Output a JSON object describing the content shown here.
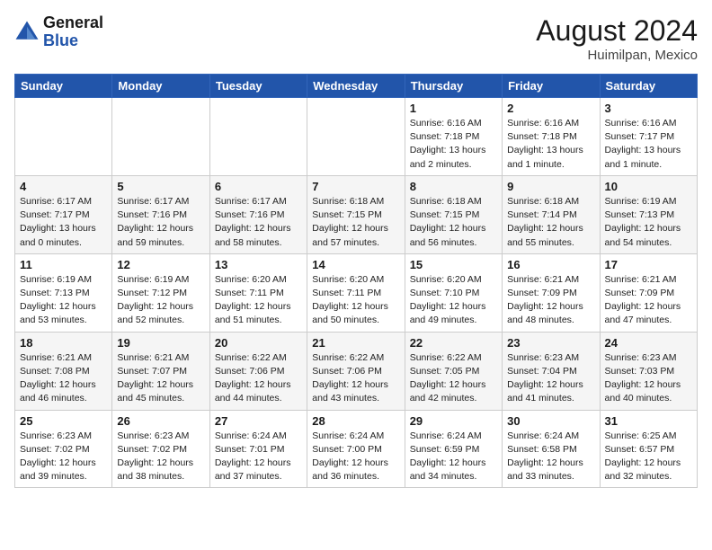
{
  "header": {
    "logo_line1": "General",
    "logo_line2": "Blue",
    "month_year": "August 2024",
    "location": "Huimilpan, Mexico"
  },
  "weekdays": [
    "Sunday",
    "Monday",
    "Tuesday",
    "Wednesday",
    "Thursday",
    "Friday",
    "Saturday"
  ],
  "weeks": [
    [
      {
        "day": "",
        "info": ""
      },
      {
        "day": "",
        "info": ""
      },
      {
        "day": "",
        "info": ""
      },
      {
        "day": "",
        "info": ""
      },
      {
        "day": "1",
        "info": "Sunrise: 6:16 AM\nSunset: 7:18 PM\nDaylight: 13 hours\nand 2 minutes."
      },
      {
        "day": "2",
        "info": "Sunrise: 6:16 AM\nSunset: 7:18 PM\nDaylight: 13 hours\nand 1 minute."
      },
      {
        "day": "3",
        "info": "Sunrise: 6:16 AM\nSunset: 7:17 PM\nDaylight: 13 hours\nand 1 minute."
      }
    ],
    [
      {
        "day": "4",
        "info": "Sunrise: 6:17 AM\nSunset: 7:17 PM\nDaylight: 13 hours\nand 0 minutes."
      },
      {
        "day": "5",
        "info": "Sunrise: 6:17 AM\nSunset: 7:16 PM\nDaylight: 12 hours\nand 59 minutes."
      },
      {
        "day": "6",
        "info": "Sunrise: 6:17 AM\nSunset: 7:16 PM\nDaylight: 12 hours\nand 58 minutes."
      },
      {
        "day": "7",
        "info": "Sunrise: 6:18 AM\nSunset: 7:15 PM\nDaylight: 12 hours\nand 57 minutes."
      },
      {
        "day": "8",
        "info": "Sunrise: 6:18 AM\nSunset: 7:15 PM\nDaylight: 12 hours\nand 56 minutes."
      },
      {
        "day": "9",
        "info": "Sunrise: 6:18 AM\nSunset: 7:14 PM\nDaylight: 12 hours\nand 55 minutes."
      },
      {
        "day": "10",
        "info": "Sunrise: 6:19 AM\nSunset: 7:13 PM\nDaylight: 12 hours\nand 54 minutes."
      }
    ],
    [
      {
        "day": "11",
        "info": "Sunrise: 6:19 AM\nSunset: 7:13 PM\nDaylight: 12 hours\nand 53 minutes."
      },
      {
        "day": "12",
        "info": "Sunrise: 6:19 AM\nSunset: 7:12 PM\nDaylight: 12 hours\nand 52 minutes."
      },
      {
        "day": "13",
        "info": "Sunrise: 6:20 AM\nSunset: 7:11 PM\nDaylight: 12 hours\nand 51 minutes."
      },
      {
        "day": "14",
        "info": "Sunrise: 6:20 AM\nSunset: 7:11 PM\nDaylight: 12 hours\nand 50 minutes."
      },
      {
        "day": "15",
        "info": "Sunrise: 6:20 AM\nSunset: 7:10 PM\nDaylight: 12 hours\nand 49 minutes."
      },
      {
        "day": "16",
        "info": "Sunrise: 6:21 AM\nSunset: 7:09 PM\nDaylight: 12 hours\nand 48 minutes."
      },
      {
        "day": "17",
        "info": "Sunrise: 6:21 AM\nSunset: 7:09 PM\nDaylight: 12 hours\nand 47 minutes."
      }
    ],
    [
      {
        "day": "18",
        "info": "Sunrise: 6:21 AM\nSunset: 7:08 PM\nDaylight: 12 hours\nand 46 minutes."
      },
      {
        "day": "19",
        "info": "Sunrise: 6:21 AM\nSunset: 7:07 PM\nDaylight: 12 hours\nand 45 minutes."
      },
      {
        "day": "20",
        "info": "Sunrise: 6:22 AM\nSunset: 7:06 PM\nDaylight: 12 hours\nand 44 minutes."
      },
      {
        "day": "21",
        "info": "Sunrise: 6:22 AM\nSunset: 7:06 PM\nDaylight: 12 hours\nand 43 minutes."
      },
      {
        "day": "22",
        "info": "Sunrise: 6:22 AM\nSunset: 7:05 PM\nDaylight: 12 hours\nand 42 minutes."
      },
      {
        "day": "23",
        "info": "Sunrise: 6:23 AM\nSunset: 7:04 PM\nDaylight: 12 hours\nand 41 minutes."
      },
      {
        "day": "24",
        "info": "Sunrise: 6:23 AM\nSunset: 7:03 PM\nDaylight: 12 hours\nand 40 minutes."
      }
    ],
    [
      {
        "day": "25",
        "info": "Sunrise: 6:23 AM\nSunset: 7:02 PM\nDaylight: 12 hours\nand 39 minutes."
      },
      {
        "day": "26",
        "info": "Sunrise: 6:23 AM\nSunset: 7:02 PM\nDaylight: 12 hours\nand 38 minutes."
      },
      {
        "day": "27",
        "info": "Sunrise: 6:24 AM\nSunset: 7:01 PM\nDaylight: 12 hours\nand 37 minutes."
      },
      {
        "day": "28",
        "info": "Sunrise: 6:24 AM\nSunset: 7:00 PM\nDaylight: 12 hours\nand 36 minutes."
      },
      {
        "day": "29",
        "info": "Sunrise: 6:24 AM\nSunset: 6:59 PM\nDaylight: 12 hours\nand 34 minutes."
      },
      {
        "day": "30",
        "info": "Sunrise: 6:24 AM\nSunset: 6:58 PM\nDaylight: 12 hours\nand 33 minutes."
      },
      {
        "day": "31",
        "info": "Sunrise: 6:25 AM\nSunset: 6:57 PM\nDaylight: 12 hours\nand 32 minutes."
      }
    ]
  ]
}
